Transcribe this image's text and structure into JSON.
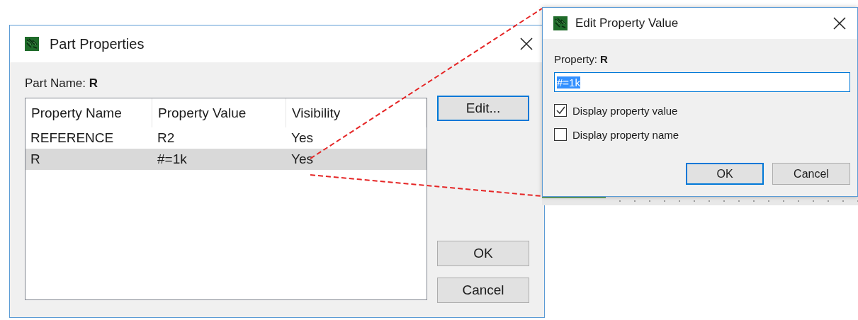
{
  "part_properties": {
    "title": "Part Properties",
    "part_name": "Part Name: **R**",
    "columns": [
      "Property Name",
      "Property Value",
      "Visibility"
    ],
    "rows": [
      {
        "cells": [
          "REFERENCE",
          "R2",
          "Yes"
        ],
        "selected": false
      },
      {
        "cells": [
          "R",
          "#=1k",
          "Yes"
        ],
        "selected": true
      }
    ],
    "buttons": [
      {
        "label": "Edit...",
        "focused": true
      },
      {
        "label": "OK",
        "focused": false
      },
      {
        "label": "Cancel",
        "focused": false
      }
    ]
  },
  "edit_dialog": {
    "title": "Edit Property Value",
    "property": "Property: **R**",
    "value": {
      "text": "#=1k",
      "selected": true
    },
    "checkboxes": [
      {
        "label": "Display property value",
        "checked": true
      },
      {
        "label": "Display property name",
        "checked": false
      }
    ],
    "buttons": [
      {
        "label": "OK",
        "focused": true
      },
      {
        "label": "Cancel",
        "focused": false
      }
    ]
  }
}
